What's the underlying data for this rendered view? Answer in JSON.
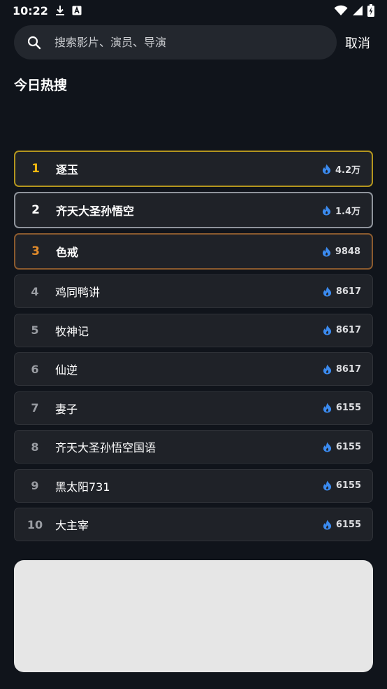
{
  "status_bar": {
    "time": "10:22",
    "left_icons": [
      "download-icon",
      "a-notification-icon"
    ],
    "right_icons": [
      "wifi-icon",
      "signal-icon",
      "battery-charging-icon"
    ]
  },
  "search": {
    "placeholder": "搜索影片、演员、导演",
    "cancel_label": "取消"
  },
  "section": {
    "title": "今日热搜"
  },
  "colors": {
    "background": "#10141b",
    "item_bg": "#1f2228",
    "rank1": "#f2b80f",
    "rank2": "#ffffff",
    "rank3": "#e38c2b",
    "flame": "#3b8bf0"
  },
  "hot_list": [
    {
      "rank": "1",
      "title": "逐玉",
      "heat": "4.2万"
    },
    {
      "rank": "2",
      "title": "齐天大圣孙悟空",
      "heat": "1.4万"
    },
    {
      "rank": "3",
      "title": "色戒",
      "heat": "9848"
    },
    {
      "rank": "4",
      "title": "鸡同鸭讲",
      "heat": "8617"
    },
    {
      "rank": "5",
      "title": "牧神记",
      "heat": "8617"
    },
    {
      "rank": "6",
      "title": "仙逆",
      "heat": "8617"
    },
    {
      "rank": "7",
      "title": "妻子",
      "heat": "6155"
    },
    {
      "rank": "8",
      "title": "齐天大圣孙悟空国语",
      "heat": "6155"
    },
    {
      "rank": "9",
      "title": "黑太阳731",
      "heat": "6155"
    },
    {
      "rank": "10",
      "title": "大主宰",
      "heat": "6155"
    }
  ]
}
